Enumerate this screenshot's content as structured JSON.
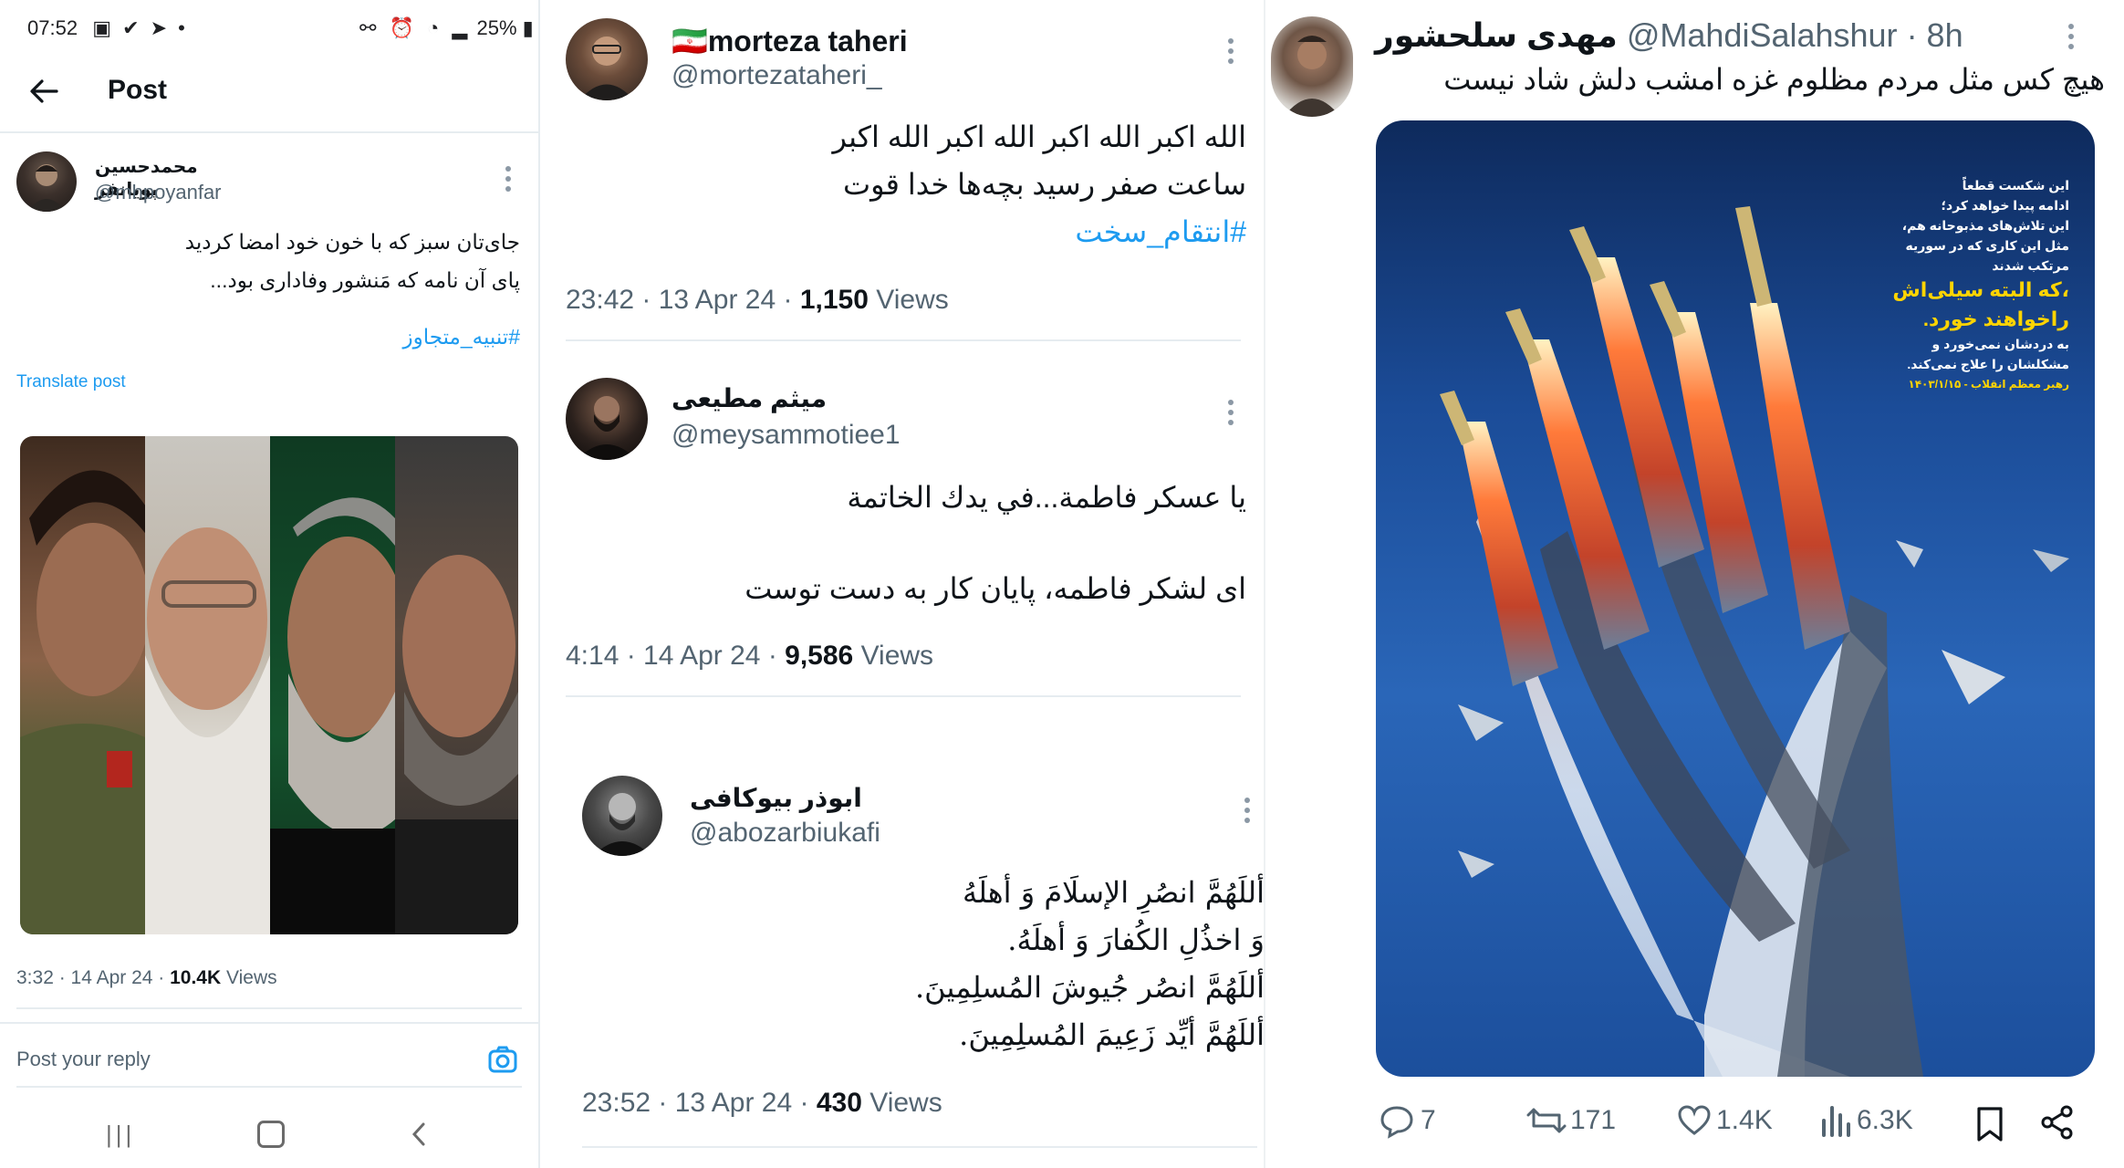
{
  "status_bar": {
    "time": "07:52",
    "icons_left": "▣ ✔ ➤ •",
    "battery": "25%"
  },
  "panel1": {
    "header_title": "Post",
    "post": {
      "display_name": "محمدحسین پویانفر",
      "handle": "@mhpoyanfar",
      "text_line1": "جای‌تان سبز که با خون خود امضا کردید",
      "text_line2": "پای آن نامه که مَنشور وفاداری بود...",
      "hashtag": "#تنبیه_متجاوز",
      "translate": "Translate post",
      "timestamp": "3:32 · 14 Apr 24 · ",
      "views_count": "10.4K",
      "views_label": " Views"
    },
    "reply_placeholder": "Post your reply"
  },
  "panel2": {
    "tweets": [
      {
        "display_name": "morteza taheri",
        "flag": "🇮🇷",
        "handle": "@mortezataheri_",
        "line1": "الله اکبر الله اکبر الله اکبر الله اکبر",
        "line2": "ساعت صفر رسید بچه‌ها خدا قوت",
        "hashtag": "#انتقام_سخت",
        "timestamp": "23:42 · 13 Apr 24 · ",
        "views_count": "1,150",
        "views_label": " Views"
      },
      {
        "display_name": "میثم مطیعی",
        "handle": "@meysammotiee1",
        "line1": "یا عسکر فاطمة...في يدك الخاتمة",
        "line2": "ای لشکر فاطمه، پایان کار به دست توست",
        "timestamp": "4:14 · 14 Apr 24 · ",
        "views_count": "9,586",
        "views_label": " Views"
      },
      {
        "display_name": "ابوذر بیوکافی",
        "handle": "@abozarbiukafi",
        "line1": "أللَهُمَّ انصُرِ الإسلَامَ وَ أهلَهُ",
        "line2": "وَ اخذُلِ الکُفارَ وَ أهلَهُ.",
        "line3": "أللَهُمَّ انصُر جُيوشَ المُسلِمِينَ.",
        "line4": "أللَهُمَّ أيِّد زَعِيمَ المُسلِمِينَ.",
        "timestamp": "23:52 · 13 Apr 24 · ",
        "views_count": "430",
        "views_label": " Views"
      }
    ]
  },
  "panel3": {
    "display_name": "مهدی سلحشور",
    "handle": "@MahdiSalahshur",
    "time": "· 8h",
    "text": "هیچ کس مثل مردم مظلوم غزه امشب دلش شاد نیست",
    "poster_text": {
      "l1": "این شکست قطعاً",
      "l2": "ادامه پیدا خواهد کرد؛",
      "l3": "این تلاش‌های مذبوحانه هم،",
      "l4": "مثل این کاری که در سوریه",
      "l5": "مرتکب شدند",
      "l6": "،که البته سیلی‌اش",
      "l7": "راخواهند خورد.",
      "l8": "به دردشان نمی‌خورد و",
      "l9": "مشکلشان را علاج نمی‌کند.",
      "l10": "رهبر معظم انقلاب - ۱۴۰۳/۱/۱۵"
    },
    "actions": {
      "replies": "7",
      "reposts": "171",
      "likes": "1.4K",
      "views": "6.3K"
    }
  },
  "colors": {
    "link": "#1d9bf0",
    "muted": "#536471",
    "divider": "#e6ecf0",
    "sky": "#1c4f9c"
  }
}
